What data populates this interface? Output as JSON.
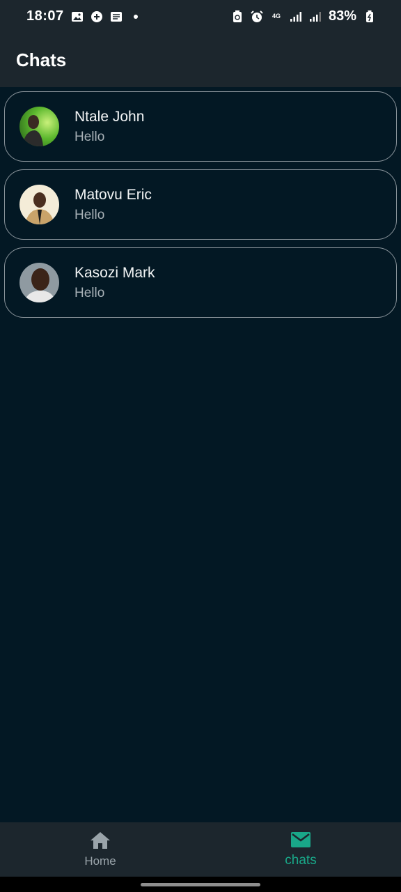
{
  "status_bar": {
    "time": "18:07",
    "network_label": "4G",
    "battery": "83%"
  },
  "app_bar": {
    "title": "Chats"
  },
  "chats": [
    {
      "name": "Ntale John",
      "message": "Hello"
    },
    {
      "name": "Matovu Eric",
      "message": "Hello"
    },
    {
      "name": "Kasozi Mark",
      "message": "Hello"
    }
  ],
  "bottom_nav": {
    "home_label": "Home",
    "chats_label": "chats",
    "active": "chats",
    "active_color": "#19a889",
    "inactive_color": "#9aa4aa"
  },
  "colors": {
    "background": "#031824",
    "bars": "#1c262d",
    "card_border": "#8a949b"
  }
}
